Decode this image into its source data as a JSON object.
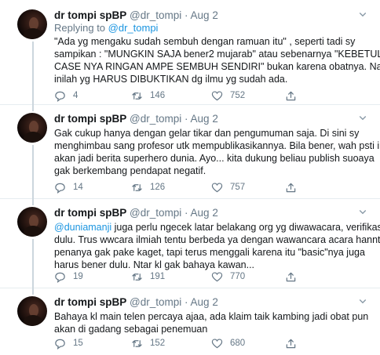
{
  "tweets": [
    {
      "name": "dr tompi spBP",
      "handle": "@dr_tompi",
      "date": "Aug 2",
      "replying_prefix": "Replying to ",
      "replying_to": "@dr_tompi",
      "lines": [
        "\"Ada yg mengaku sudah sembuh dengan ramuan itu\" , seperti tadi sy",
        "sampikan : \"MUNGKIN SAJA bener2 mujarab\" atau sebenarnya \"KEBETULAN",
        "CASE NYA RINGAN AMPE SEMBUH SENDIRI\" bukan karena obatnya. Nah",
        "inilah yg HARUS DIBUKTIKAN dg ilmu yg sudah ada."
      ],
      "replies": "4",
      "retweets": "146",
      "likes": "752"
    },
    {
      "name": "dr tompi spBP",
      "handle": "@dr_tompi",
      "date": "Aug 2",
      "lines": [
        "Gak cukup hanya dengan gelar tikar dan pengumuman saja. Di sini sy",
        "menghimbau sang profesor utk mempublikasikannya. Bila bener, wah psti ini",
        "akan jadi berita superhero dunia. Ayo... kita dukung beliau publish suoaya",
        "gak berkembang pendapat negatif."
      ],
      "replies": "14",
      "retweets": "126",
      "likes": "757"
    },
    {
      "name": "dr tompi spBP",
      "handle": "@dr_tompi",
      "date": "Aug 2",
      "first_mention": "@duniamanji",
      "first_rest": " juga perlu ngecek latar belakang org yg diwawacara, verifikasi",
      "lines": [
        "dulu. Trus wwcara ilmiah tentu berbeda ya dengan wawancara acara hanntu...",
        "penanya gak pake kaget, tapi terus menggali karena itu \"basic\"nya juga",
        "harus bener dulu. Ntar kl gak bahaya kawan..."
      ],
      "replies": "19",
      "retweets": "191",
      "likes": "770"
    },
    {
      "name": "dr tompi spBP",
      "handle": "@dr_tompi",
      "date": "Aug 2",
      "lines": [
        "Bahaya kl main telen percaya ajaa, ada klaim taik kambing jadi obat pun",
        "akan di gadang sebagai penemuan"
      ],
      "replies": "15",
      "retweets": "152",
      "likes": "680"
    }
  ],
  "icons": {
    "reply": "speech-bubble-icon",
    "retweet": "retweet-arrows-icon",
    "like": "heart-icon",
    "share": "share-upload-icon",
    "more": "chevron-down-icon"
  },
  "colors": {
    "text": "#14171a",
    "muted": "#657786",
    "link": "#1b95e0",
    "divider": "#e6ecf0",
    "thread_line": "#ccd6dd"
  }
}
